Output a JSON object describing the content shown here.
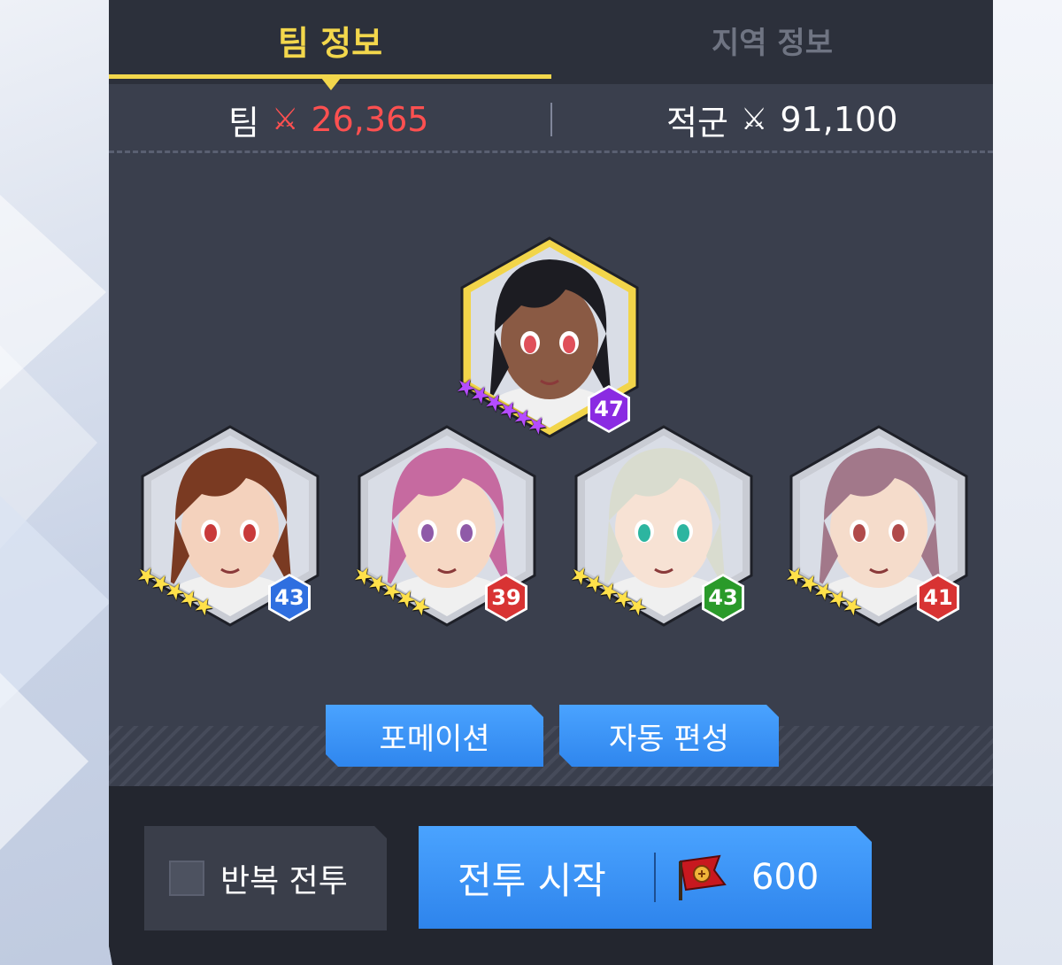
{
  "tabs": {
    "team": "팀 정보",
    "region": "지역 정보"
  },
  "power": {
    "team_label": "팀",
    "team_value": "26,365",
    "enemy_label": "적군",
    "enemy_value": "91,100",
    "icon": "crossed-swords-icon"
  },
  "leader": {
    "level": "47",
    "stars": 6,
    "star_color": "#b54cff",
    "badge_color": "#8a2be2",
    "frame_color": "#f2d54a"
  },
  "members": [
    {
      "level": "43",
      "stars": 5,
      "badge_color": "#2f6fe0",
      "hair": "#7a3a22",
      "skin": "#f4d2bd",
      "eye": "#c83a3a"
    },
    {
      "level": "39",
      "stars": 5,
      "badge_color": "#d83333",
      "hair": "#c66aa0",
      "skin": "#f6d8c4",
      "eye": "#8f5aa8"
    },
    {
      "level": "43",
      "stars": 5,
      "badge_color": "#2a9a2a",
      "hair": "#d9dccf",
      "skin": "#f7e2d4",
      "eye": "#2cb5a0"
    },
    {
      "level": "41",
      "stars": 5,
      "badge_color": "#d83333",
      "hair": "#a2788a",
      "skin": "#f5dccb",
      "eye": "#b04a4a"
    }
  ],
  "buttons": {
    "formation": "포메이션",
    "auto_formation": "자동 편성"
  },
  "bottom": {
    "repeat_label": "반복 전투",
    "start_label": "전투 시작",
    "cost": "600",
    "cost_icon": "flag-emblem-icon"
  },
  "colors": {
    "accent": "#f3d74c",
    "team_power": "#ff5050",
    "blue_button": "#3a95f8"
  }
}
